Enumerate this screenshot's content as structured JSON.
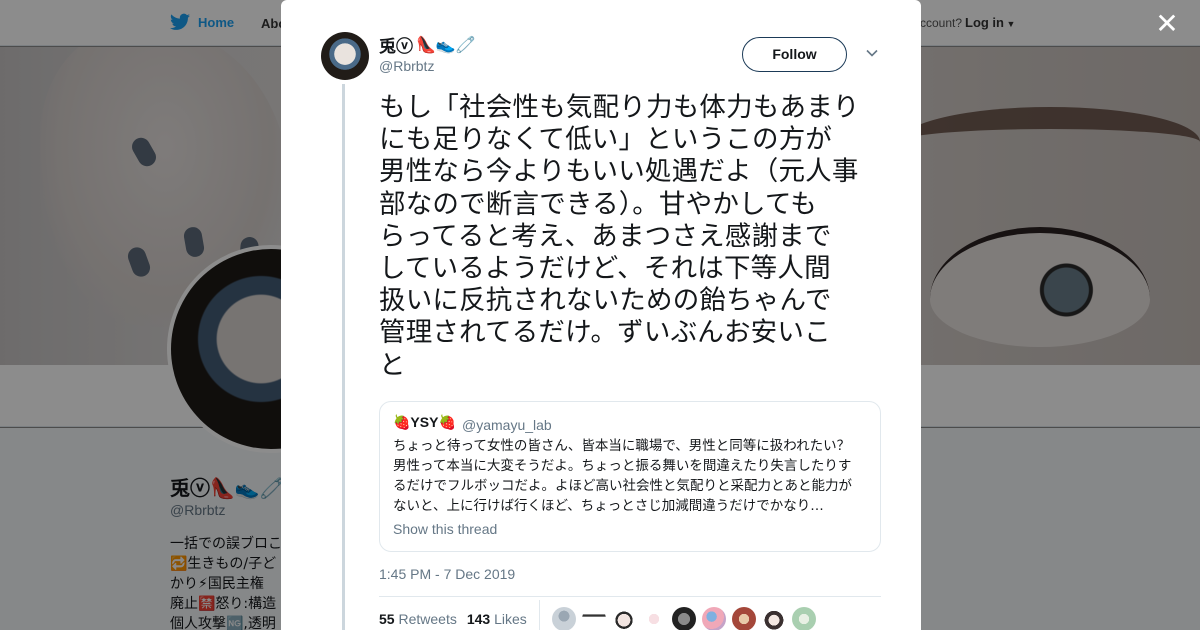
{
  "background": {
    "nav_home": "Home",
    "nav_about": "Abo",
    "account_text": "ccount?",
    "login": "Log in",
    "profile_name": "兎ⓥ👠👟🧷",
    "profile_handle": "@Rbrbtz",
    "bio": "一括での誤ブロこ\n🔁生きもの/子ど\nかり⚡国民主権\n廃止🈲怒り:構造\n個人攻撃🆖,透明"
  },
  "close_icon": "✕",
  "tweet": {
    "author_name": "兎ⓥ",
    "author_emoji": "👠👟🧷",
    "author_handle": "@Rbrbtz",
    "follow_label": "Follow",
    "text": "もし「社会性も気配り力も体力もあまり\nにも足りなくて低い」というこの方が\n男性なら今よりもいい処遇だよ（元人事\n部なので断言できる）。甘やかしても\nらってると考え、あまつさえ感謝まで\nしているようだけど、それは下等人間\n扱いに反抗されないための飴ちゃんで\n管理されてるだけ。ずいぶんお安いこ\nと",
    "quote": {
      "name": "🍓YSY🍓",
      "handle": "@yamayu_lab",
      "text": "ちょっと待って女性の皆さん、皆本当に職場で、男性と同等に扱われたい？\n男性って本当に大変そうだよ。ちょっと振る舞いを間違えたり失言したりす\nるだけでフルボッコだよ。よほど高い社会性と気配りと采配力とあと能力が\nないと、上に行けば行くほど、ちょっとさじ加減間違うだけでかなり…",
      "show_thread": "Show this thread"
    },
    "timestamp": "1:45 PM - 7 Dec 2019",
    "retweets_count": "55",
    "retweets_label": "Retweets",
    "likes_count": "143",
    "likes_label": "Likes"
  },
  "colors": {
    "link_blue": "#1da1f2",
    "text": "#14171a",
    "muted": "#657786",
    "border": "#e1e8ed"
  }
}
